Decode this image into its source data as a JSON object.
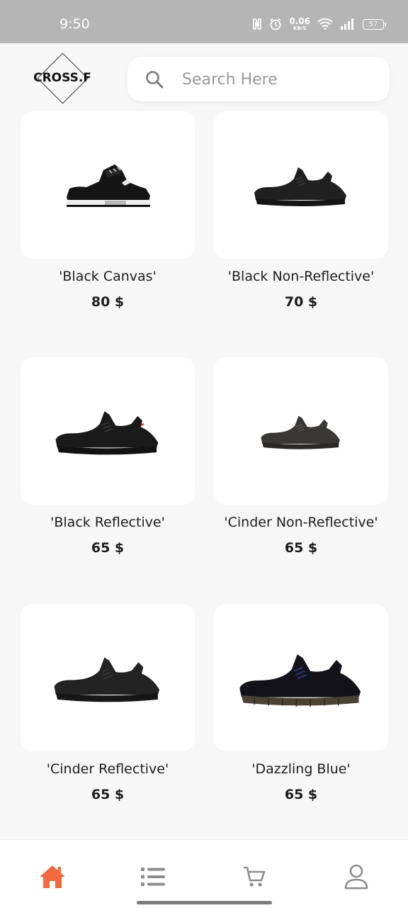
{
  "status_bar": {
    "time": "9:50",
    "net_speed_value": "0.06",
    "net_speed_unit": "KB/S",
    "battery": "57",
    "icons": [
      "nfc-icon",
      "alarm-icon",
      "wifi-icon",
      "signal-icon",
      "battery-icon"
    ]
  },
  "header": {
    "logo_text": "CROSS.F",
    "search_placeholder": "Search Here",
    "search_value": ""
  },
  "products": [
    {
      "name": "'Black Canvas'",
      "price": "80 $",
      "shoe": "jordan"
    },
    {
      "name": "'Black Non-Reflective'",
      "price": "70 $",
      "shoe": "yeezy"
    },
    {
      "name": "'Black Reflective'",
      "price": "65 $",
      "shoe": "yeezy"
    },
    {
      "name": "'Cinder Non-Reflective'",
      "price": "65 $",
      "shoe": "yeezy-grey"
    },
    {
      "name": "'Cinder Reflective'",
      "price": "65 $",
      "shoe": "yeezy"
    },
    {
      "name": "'Dazzling Blue'",
      "price": "65 $",
      "shoe": "yeezy-blue"
    }
  ],
  "bottom_nav": {
    "items": [
      "home",
      "list",
      "cart",
      "profile"
    ],
    "active": "home",
    "active_color": "#f26a3d",
    "inactive_color": "#8c8c8c"
  }
}
